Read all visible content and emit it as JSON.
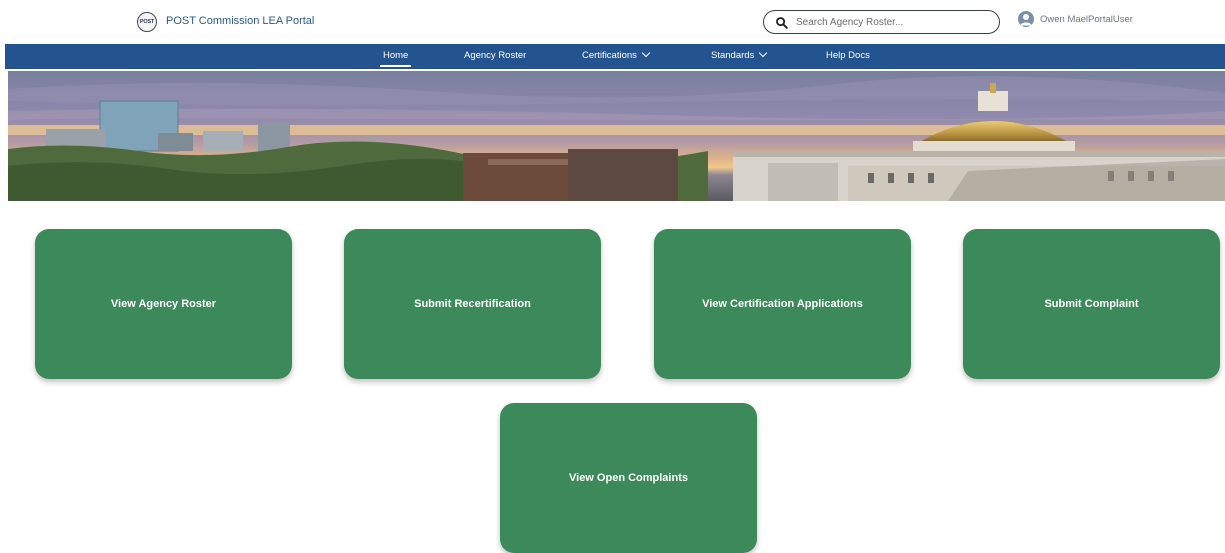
{
  "header": {
    "logo_text": "POST",
    "portal_title": "POST Commission LEA Portal",
    "search": {
      "placeholder": "Search Agency Roster...",
      "value": ""
    },
    "user_name": "Owen MaelPortalUser"
  },
  "nav": {
    "items": [
      {
        "label": "Home",
        "active": true,
        "dropdown": false
      },
      {
        "label": "Agency Roster",
        "active": false,
        "dropdown": false
      },
      {
        "label": "Certifications",
        "active": false,
        "dropdown": true
      },
      {
        "label": "Standards",
        "active": false,
        "dropdown": true
      },
      {
        "label": "Help Docs",
        "active": false,
        "dropdown": false
      }
    ]
  },
  "colors": {
    "nav_background": "#23548f",
    "tile_background": "#3c8a5a",
    "portal_title": "#2a5a8a"
  },
  "tiles": [
    {
      "label": "View Agency Roster"
    },
    {
      "label": "Submit Recertification"
    },
    {
      "label": "View Certification Applications"
    },
    {
      "label": "Submit Complaint"
    },
    {
      "label": "View Open Complaints"
    }
  ]
}
